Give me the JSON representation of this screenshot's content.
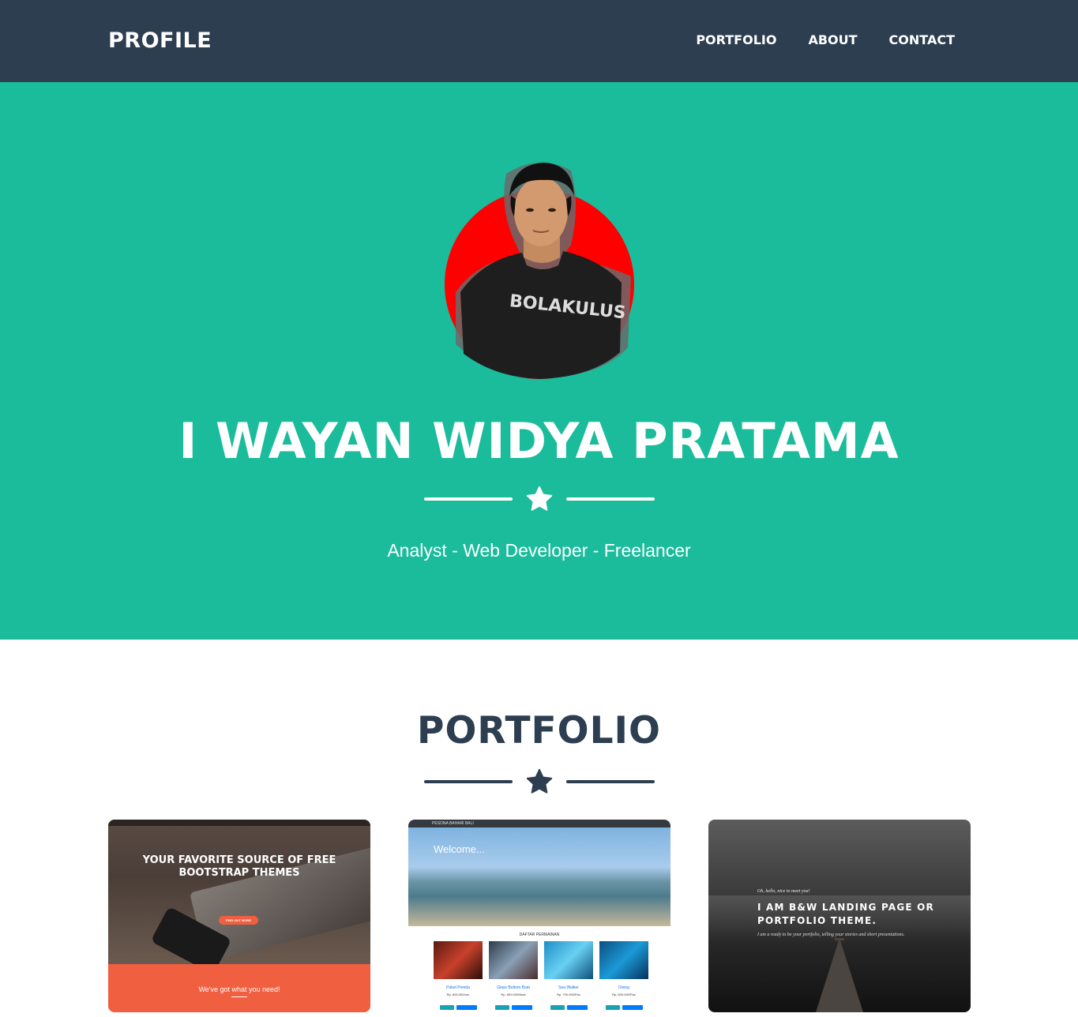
{
  "navbar": {
    "brand": "PROFILE",
    "links": [
      "PORTFOLIO",
      "ABOUT",
      "CONTACT"
    ]
  },
  "hero": {
    "name": "I WAYAN WIDYA PRATAMA",
    "subtitle": "Analyst - Web Developer - Freelancer",
    "divider_icon": "star-icon",
    "avatar_accent": "#ff0000"
  },
  "portfolio": {
    "title": "PORTFOLIO",
    "divider_icon": "star-icon",
    "items": [
      {
        "title": "YOUR FAVORITE SOURCE OF FREE BOOTSTRAP THEMES",
        "button": "FIND OUT MORE",
        "subheading": "We've got what you need!"
      },
      {
        "brand": "PESONA BAHARI BALI",
        "heading": "Welcome...",
        "section_label": "DAFTAR PERMAINAN",
        "games": [
          {
            "name": "Paket Penida",
            "price": "Rp. 800.000/orn"
          },
          {
            "name": "Glass Bottom Boat",
            "price": "Rp. 800.000/Boat"
          },
          {
            "name": "Sea Walker",
            "price": "Rp. 700.000/Pax"
          },
          {
            "name": "Diving",
            "price": "Rp. 600.000/Pax"
          }
        ]
      },
      {
        "greeting": "Oh, hello, nice to meet you!",
        "title": "I AM B&W LANDING PAGE OR PORTFOLIO THEME.",
        "text": "I am a ready to be your portfolio, telling your stories and short presentations."
      }
    ]
  },
  "colors": {
    "navbar": "#2c3e50",
    "hero": "#1abc9c",
    "text_dark": "#2c3e50",
    "accent_orange": "#f05f40"
  }
}
